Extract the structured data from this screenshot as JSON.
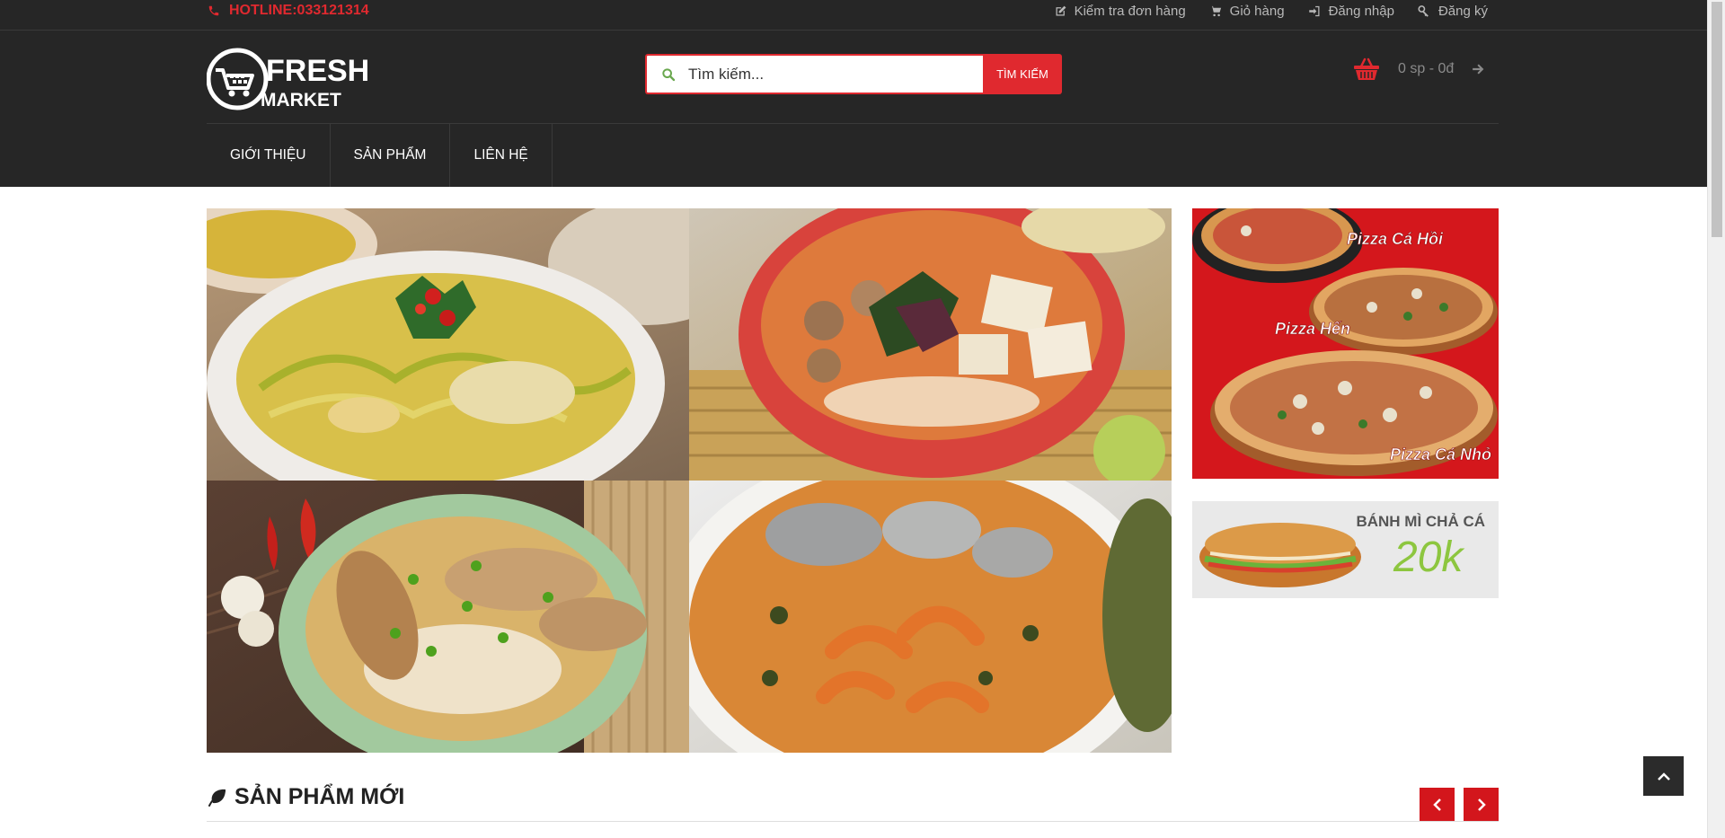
{
  "topbar": {
    "hotline": "HOTLINE:033121314",
    "links": [
      {
        "label": "Kiểm tra đơn hàng",
        "icon": "edit-icon"
      },
      {
        "label": "Giỏ hàng",
        "icon": "cart-icon"
      },
      {
        "label": "Đăng nhập",
        "icon": "login-icon"
      },
      {
        "label": "Đăng ký",
        "icon": "key-icon"
      }
    ]
  },
  "logo": {
    "line1": "FRESH",
    "line2": "MARKET"
  },
  "search": {
    "placeholder": "Tìm kiếm...",
    "button": "TÌM KIẾM"
  },
  "cart": {
    "summary": "0 sp - 0đ"
  },
  "nav": {
    "items": [
      "GIỚI THIỆU",
      "SẢN PHẨM",
      "LIÊN HỆ"
    ]
  },
  "banners": {
    "pizza": {
      "labels": [
        "Pizza Cá Hồi",
        "Pizza Hến",
        "Pizza Cá Nhỏ"
      ]
    },
    "banhmi": {
      "title": "BÁNH MÌ CHẢ CÁ",
      "price": "20k"
    }
  },
  "section": {
    "title": "SẢN PHẨM MỚI"
  },
  "colors": {
    "accent": "#e0292f",
    "header_bg": "#262626",
    "banner_red": "#d3161c",
    "price_green": "#8dc63f"
  }
}
